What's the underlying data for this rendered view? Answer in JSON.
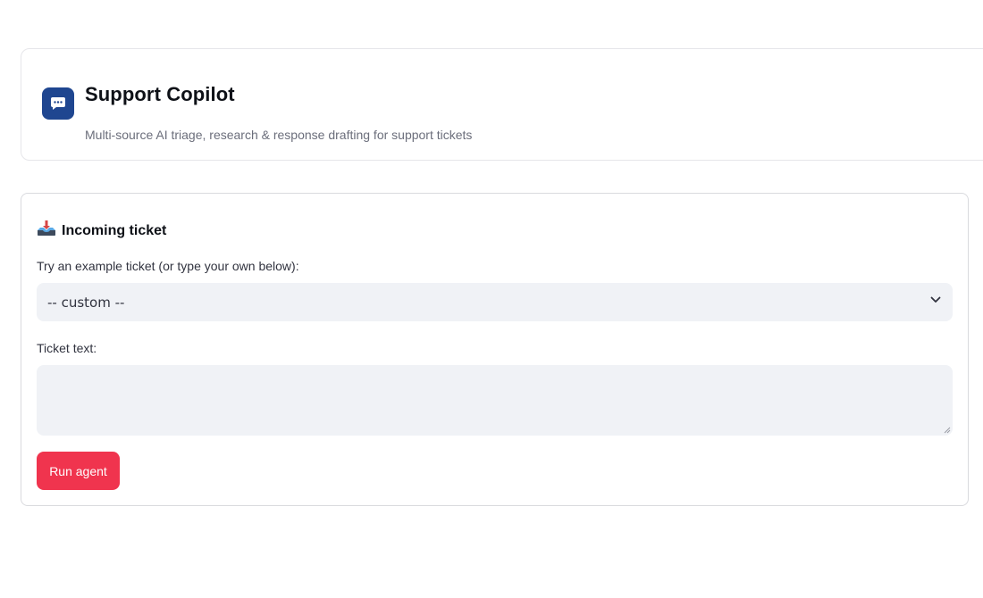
{
  "header": {
    "title": "Support Copilot",
    "subtitle": "Multi-source AI triage, research & response drafting for support tickets",
    "icon": "chat-bubble-icon",
    "accent_color": "#1f4690"
  },
  "ticket": {
    "heading": "Incoming ticket",
    "heading_icon": "inbox-tray-icon",
    "example_label": "Try an example ticket (or type your own below):",
    "example_selected": "-- custom --",
    "text_label": "Ticket text:",
    "text_value": "",
    "run_label": "Run agent",
    "run_color": "#f0344e"
  }
}
